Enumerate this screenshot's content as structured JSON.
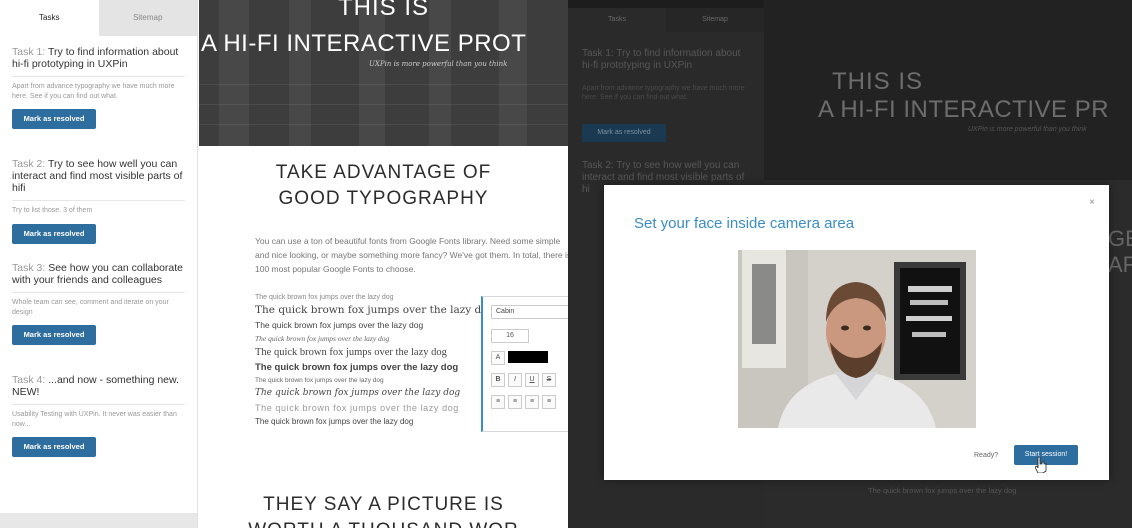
{
  "left_panel": {
    "tabs": [
      "Tasks",
      "Sitemap"
    ],
    "tasks": [
      {
        "num": "Task 1:",
        "title": "Try to find information about hi-fi prototyping in UXPin",
        "desc": "Apart from advance typography we have much more here. See if you can find out what.",
        "button": "Mark as resolved"
      },
      {
        "num": "Task 2:",
        "title": "Try to see how well you can interact and find most visible parts of hifi",
        "desc": "Try to list those. 3 of them",
        "button": "Mark as resolved"
      },
      {
        "num": "Task 3:",
        "title": "See how you can collaborate with your friends and colleagues",
        "desc": "Whole team can see, comment and iterate on your design",
        "button": "Mark as resolved"
      },
      {
        "num": "Task 4:",
        "title": "...and now - something new. NEW!",
        "desc": "Usability Testing with UXPin. It never was easier than now...",
        "button": "Mark as resolved"
      }
    ]
  },
  "preview": {
    "hero_title_1": "THIS IS",
    "hero_title_2": "A HI-FI INTERACTIVE PROT",
    "hero_subtitle": "UXPin is more powerful than you think",
    "section_title_1": "TAKE ADVANTAGE OF",
    "section_title_2": "GOOD TYPOGRAPHY",
    "intro": "You can use a ton of beautiful fonts from Google Fonts library. Need some simple and nice looking, or maybe something more fancy? We've got them. In total, there is 100 most popular Google Fonts to choose.",
    "font_sample": "The quick brown fox jumps over the lazy dog",
    "editor": {
      "font": "Cabin",
      "size": "16",
      "bold": "B",
      "italic": "I",
      "underline": "U",
      "strike": "S"
    },
    "bottom_title_1": "THEY SAY A PICTURE IS",
    "bottom_title_2": "WORTH A THOUSAND WOR"
  },
  "right_bg": {
    "tabs": [
      "Tasks",
      "Sitemap"
    ],
    "task1": "Task 1:  Try to find information about hi-fi prototyping in UXPin",
    "task1_desc": "Apart from advance typography we have much more here. See if you can find out what.",
    "button": "Mark as resolved",
    "task2": "Task 2:  Try to see how well you can interact and find most visible parts of hi",
    "hero_title_1": "THIS IS",
    "hero_title_2": "A HI-FI INTERACTIVE PR",
    "hero_subtitle": "UXPin is more powerful than you think",
    "side_1": "GE",
    "side_2": "AF",
    "bottom": "The quick brown fox jumps over the lazy dog"
  },
  "modal": {
    "title": "Set your face inside camera area",
    "close": "×",
    "ready": "Ready?",
    "start_button": "Start session!"
  }
}
